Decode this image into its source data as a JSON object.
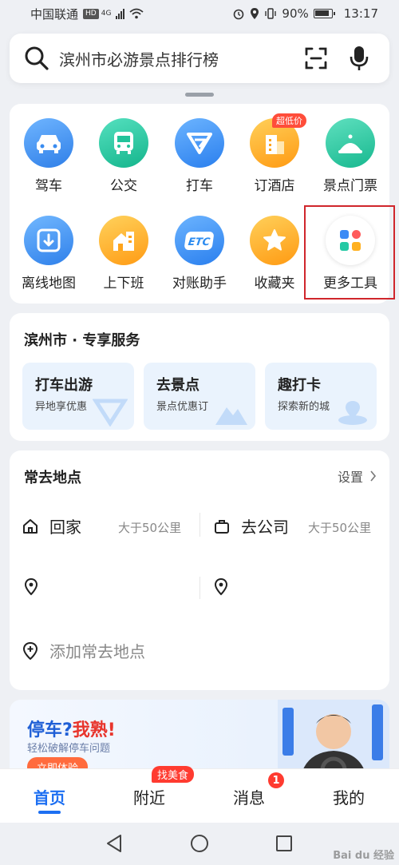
{
  "status_bar": {
    "carrier": "中国联通",
    "hd": "HD",
    "network": "4G",
    "battery": "90%",
    "time": "13:17"
  },
  "search": {
    "text": "滨州市必游景点排行榜"
  },
  "tools": [
    {
      "label": "驾车",
      "icon": "car-icon",
      "color": "#3a8cf0"
    },
    {
      "label": "公交",
      "icon": "bus-icon",
      "color": "#22c39a"
    },
    {
      "label": "打车",
      "icon": "taxi-icon",
      "color": "#2d8cf0"
    },
    {
      "label": "订酒店",
      "icon": "hotel-icon",
      "color": "#ffa41b",
      "badge": "超低价"
    },
    {
      "label": "景点门票",
      "icon": "scenic-icon",
      "color": "#27c8a0"
    },
    {
      "label": "离线地图",
      "icon": "offline-map-icon",
      "color": "#3d8ff2"
    },
    {
      "label": "上下班",
      "icon": "commute-icon",
      "color": "#ffa41b"
    },
    {
      "label": "对账助手",
      "icon": "etc-icon",
      "color": "#2d8cf0",
      "etc_text": "ETC"
    },
    {
      "label": "收藏夹",
      "icon": "favorites-icon",
      "color": "#ffa41b"
    },
    {
      "label": "更多工具",
      "icon": "more-tools-icon",
      "color": "#ffffff"
    }
  ],
  "exclusive": {
    "title": "滨州市 · 专享服务",
    "items": [
      {
        "title": "打车出游",
        "sub": "异地享优惠"
      },
      {
        "title": "去景点",
        "sub": "景点优惠订"
      },
      {
        "title": "趣打卡",
        "sub": "探索新的城"
      }
    ]
  },
  "places": {
    "title": "常去地点",
    "settings": "设置",
    "home": {
      "name": "回家",
      "dist": "大于50公里"
    },
    "work": {
      "name": "去公司",
      "dist": "大于50公里"
    },
    "add": "添加常去地点"
  },
  "banner": {
    "title_a": "停车?",
    "title_b": "我熟!",
    "sub": "轻松破解停车问题",
    "cta": "立即体验"
  },
  "tabs": {
    "home": "首页",
    "nearby": "附近",
    "nearby_badge": "找美食",
    "messages": "消息",
    "messages_count": "1",
    "mine": "我的"
  },
  "watermark": "Bai du 经验"
}
